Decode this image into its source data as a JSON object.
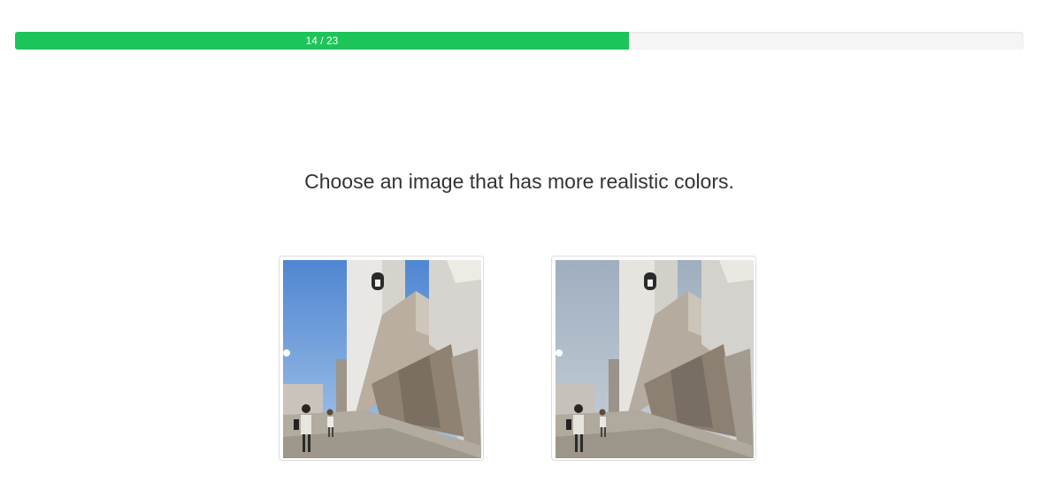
{
  "progress": {
    "label": "14 / 23",
    "current": 14,
    "total": 23,
    "color": "#1cc45a"
  },
  "question": "Choose an image that has more realistic colors.",
  "choices": [
    {
      "name": "image-option-a",
      "sky_color": "#5b8ed6"
    },
    {
      "name": "image-option-b",
      "sky_color": "#aab7c8"
    }
  ]
}
